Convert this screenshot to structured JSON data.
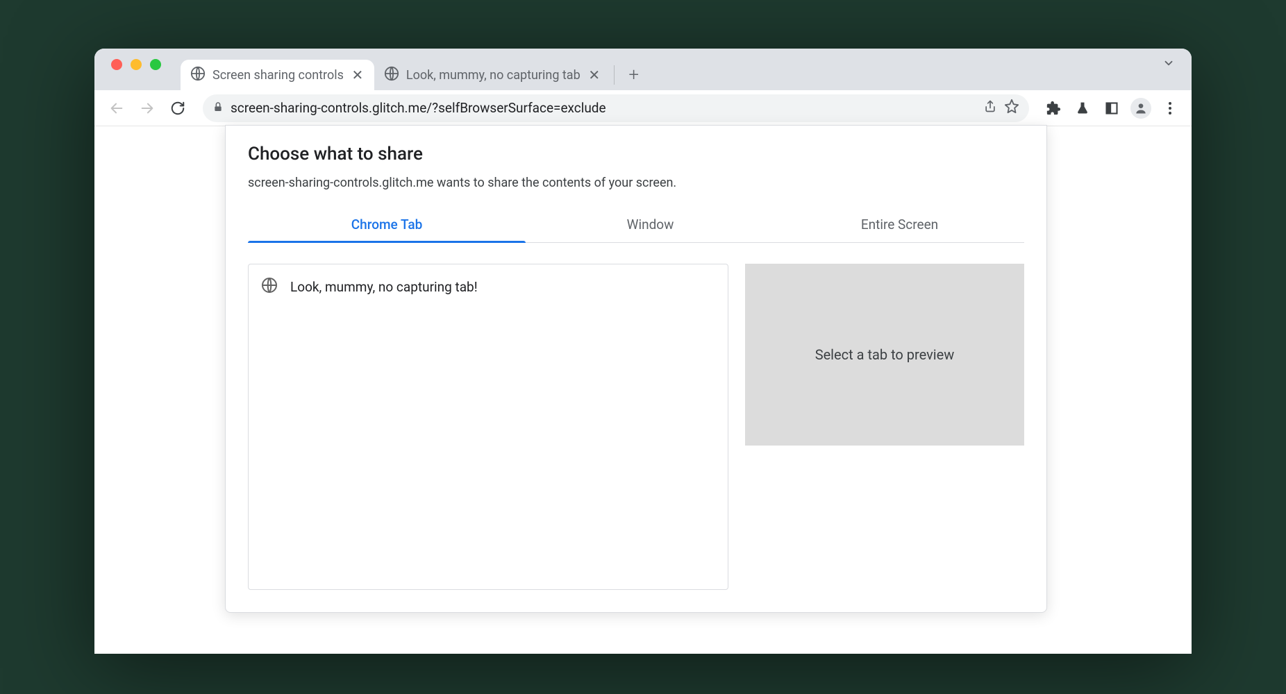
{
  "browser": {
    "tabs": [
      {
        "title": "Screen sharing controls",
        "active": true
      },
      {
        "title": "Look, mummy, no capturing tab",
        "active": false
      }
    ],
    "url": "screen-sharing-controls.glitch.me/?selfBrowserSurface=exclude"
  },
  "dialog": {
    "title": "Choose what to share",
    "description": "screen-sharing-controls.glitch.me wants to share the contents of your screen.",
    "tabs": [
      "Chrome Tab",
      "Window",
      "Entire Screen"
    ],
    "active_tab": "Chrome Tab",
    "tab_list": [
      {
        "title": "Look, mummy, no capturing tab!"
      }
    ],
    "preview_placeholder": "Select a tab to preview"
  }
}
